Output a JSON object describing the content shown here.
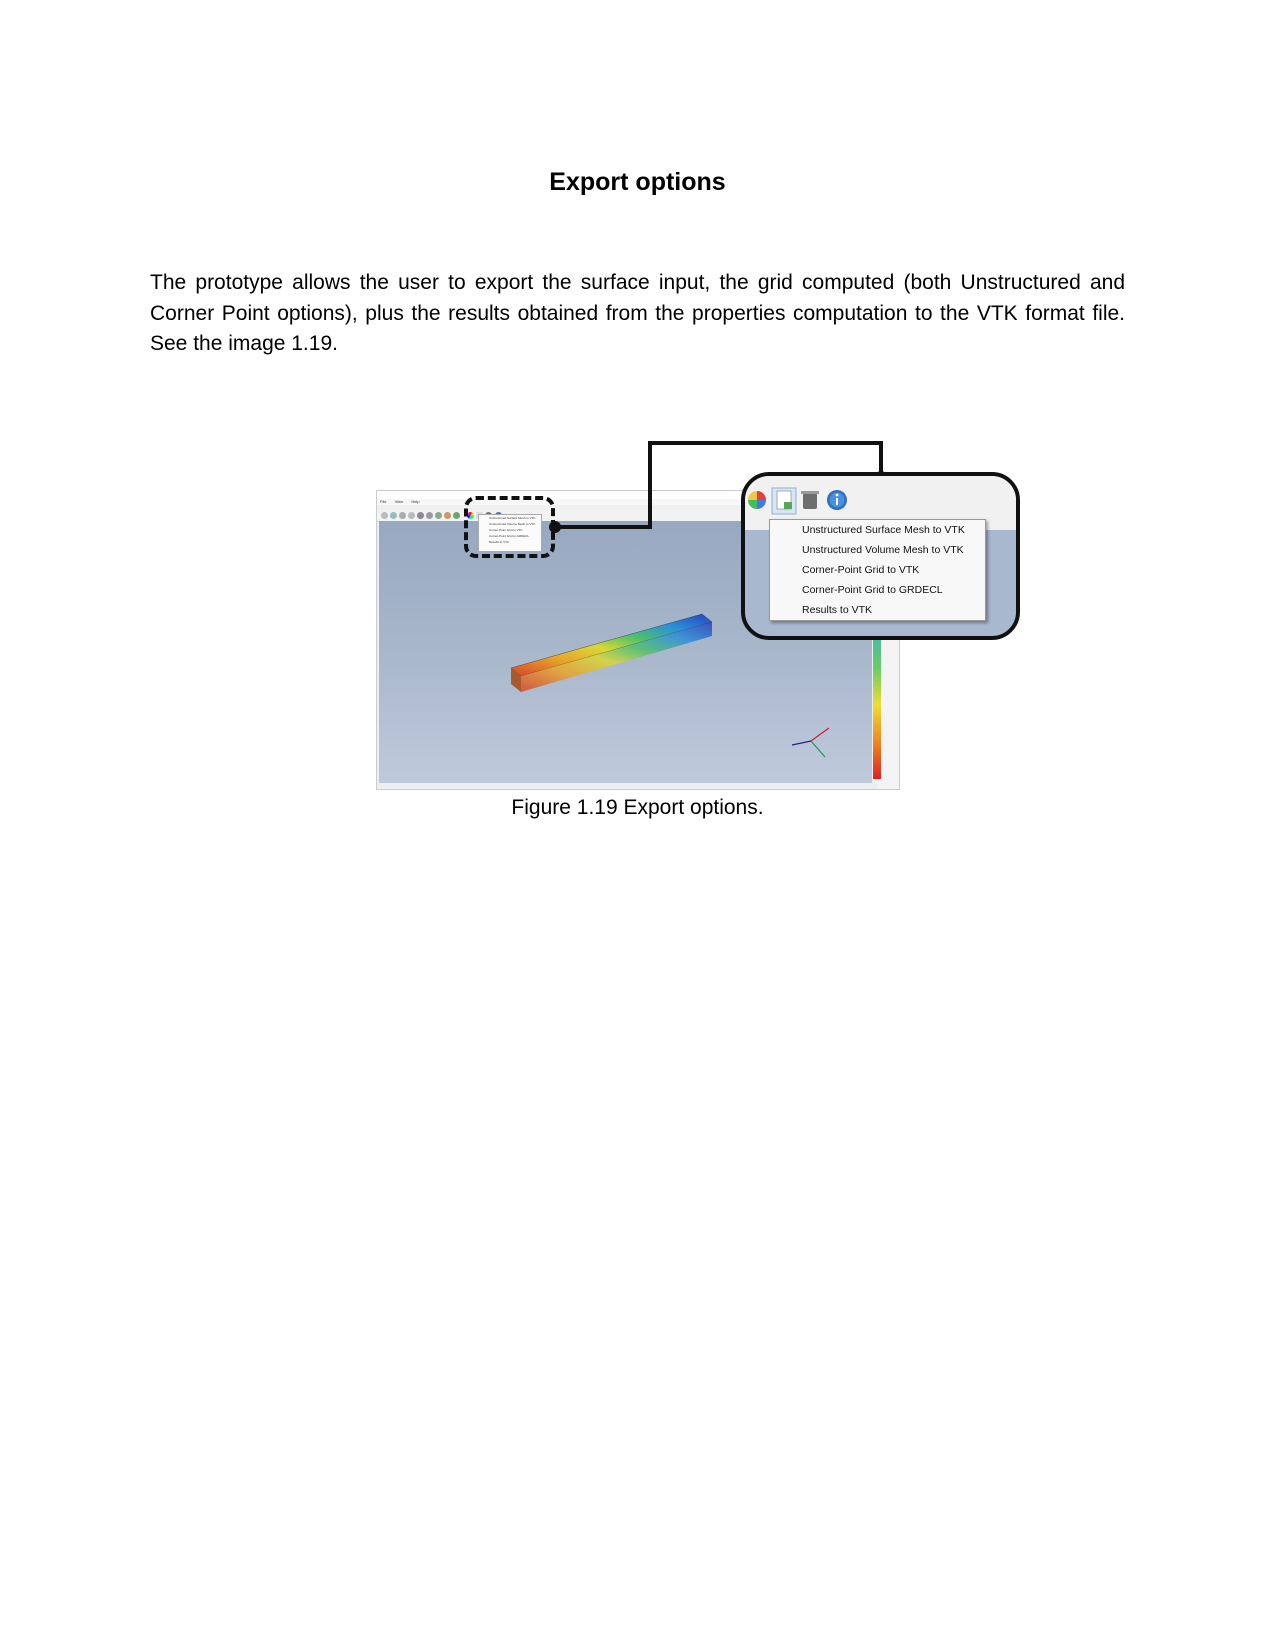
{
  "heading": "Export options",
  "paragraph": "The prototype allows the user to export the surface input, the grid computed (both Unstructured and Corner Point options), plus the results obtained from the properties computation to the VTK format file. See the image 1.19.",
  "figure": {
    "caption": "Figure 1.19 Export options.",
    "app": {
      "menu_items": [
        "File",
        "View",
        "Help"
      ],
      "export_menu": [
        "Unstructured Surface Mesh to VTK",
        "Unstructured Volume Mesh to VTK",
        "Corner-Point Grid to VTK",
        "Corner-Point Grid to GRDECL",
        "Results to VTK"
      ]
    },
    "icons": [
      "color-wheel-icon",
      "export-file-icon",
      "trash-icon",
      "info-icon"
    ]
  }
}
